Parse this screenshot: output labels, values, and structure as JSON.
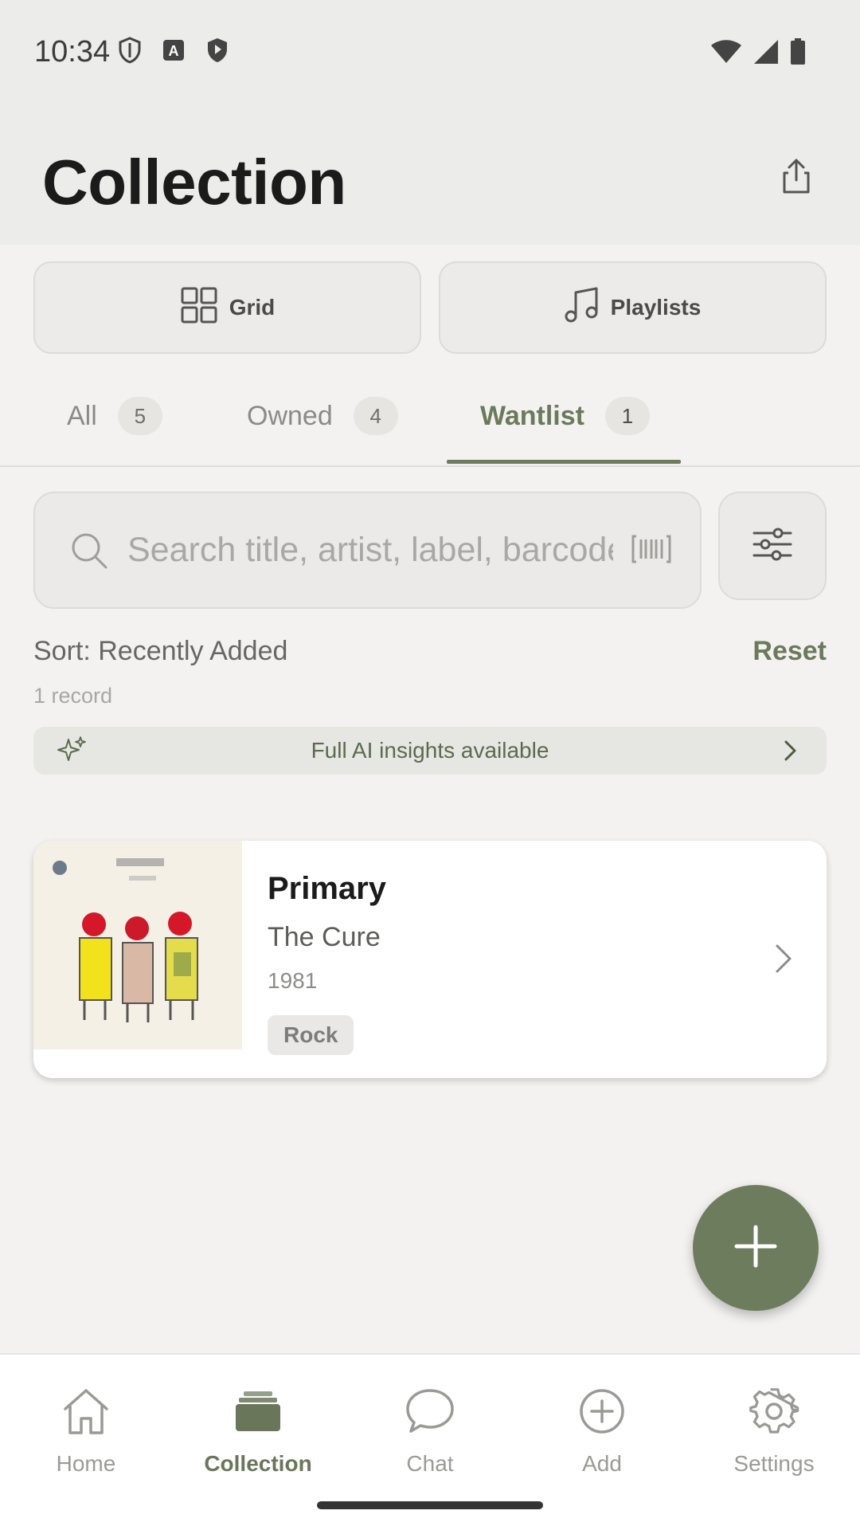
{
  "status": {
    "time": "10:34"
  },
  "header": {
    "title": "Collection"
  },
  "view_toggle": {
    "grid_label": "Grid",
    "playlists_label": "Playlists"
  },
  "tabs": [
    {
      "label": "All",
      "count": "5"
    },
    {
      "label": "Owned",
      "count": "4"
    },
    {
      "label": "Wantlist",
      "count": "1"
    }
  ],
  "search": {
    "placeholder": "Search title, artist, label, barcode"
  },
  "sort": {
    "label": "Sort: Recently Added",
    "reset_label": "Reset",
    "record_count": "1 record"
  },
  "ai_banner": {
    "text": "Full AI insights available"
  },
  "records": [
    {
      "title": "Primary",
      "artist": "The Cure",
      "year": "1981",
      "genre": "Rock"
    }
  ],
  "nav": [
    {
      "label": "Home",
      "icon": "home-icon"
    },
    {
      "label": "Collection",
      "icon": "collection-icon"
    },
    {
      "label": "Chat",
      "icon": "chat-icon"
    },
    {
      "label": "Add",
      "icon": "add-circle-icon"
    },
    {
      "label": "Settings",
      "icon": "gear-icon"
    }
  ],
  "colors": {
    "accent": "#6e7c5e",
    "background": "#f3f2f0",
    "header": "#ececeb"
  }
}
